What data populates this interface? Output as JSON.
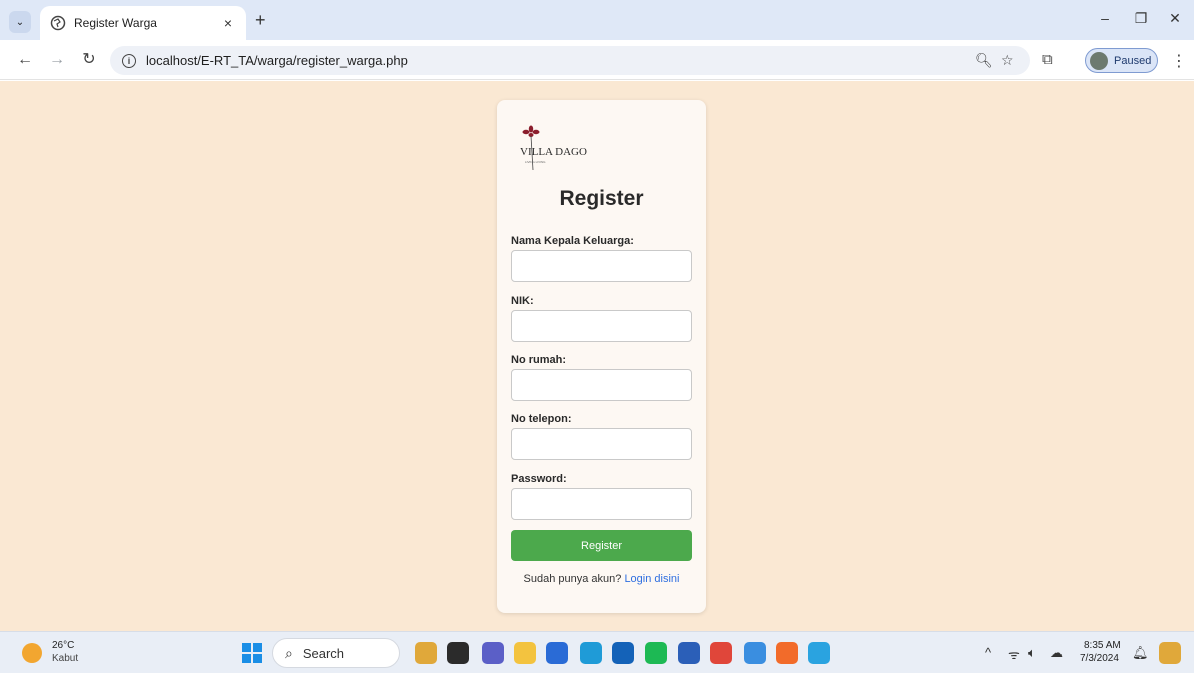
{
  "browser": {
    "tab_title": "Register Warga",
    "new_tab": "+",
    "close_tab": "×",
    "url": "localhost/E-RT_TA/warga/register_warga.php",
    "paused_label": "Paused"
  },
  "logo": {
    "line1": "VILLA DAGO",
    "line2": "LIVING LIVING"
  },
  "form": {
    "title": "Register",
    "fields": [
      {
        "label": "Nama Kepala Keluarga:",
        "value": ""
      },
      {
        "label": "NIK:",
        "value": ""
      },
      {
        "label": "No rumah:",
        "value": ""
      },
      {
        "label": "No telepon:",
        "value": ""
      },
      {
        "label": "Password:",
        "value": ""
      }
    ],
    "submit_label": "Register",
    "footer_text": "Sudah punya akun?",
    "login_link": "Login disini"
  },
  "taskbar": {
    "weather_temp": "26°C",
    "weather_desc": "Kabut",
    "search_label": "Search",
    "time": "8:35 AM",
    "date": "7/3/2024",
    "pinned_apps": [
      {
        "name": "widgets-app",
        "color": "#e0a83a"
      },
      {
        "name": "task-view-app",
        "color": "#2b2b2b"
      },
      {
        "name": "teams-app",
        "color": "#5b5fc7"
      },
      {
        "name": "file-explorer-app",
        "color": "#f3c33f"
      },
      {
        "name": "store-app",
        "color": "#2a6bd6"
      },
      {
        "name": "edge-app",
        "color": "#1f9bd7"
      },
      {
        "name": "mail-app",
        "color": "#1462b8"
      },
      {
        "name": "spotify-app",
        "color": "#1db954"
      },
      {
        "name": "word-app",
        "color": "#2b5fb8"
      },
      {
        "name": "chrome-app",
        "color": "#e0463a"
      },
      {
        "name": "terminal-app",
        "color": "#3a8ee0"
      },
      {
        "name": "xampp-app",
        "color": "#f26b2a"
      },
      {
        "name": "paint-app",
        "color": "#2aa3e0"
      }
    ]
  }
}
